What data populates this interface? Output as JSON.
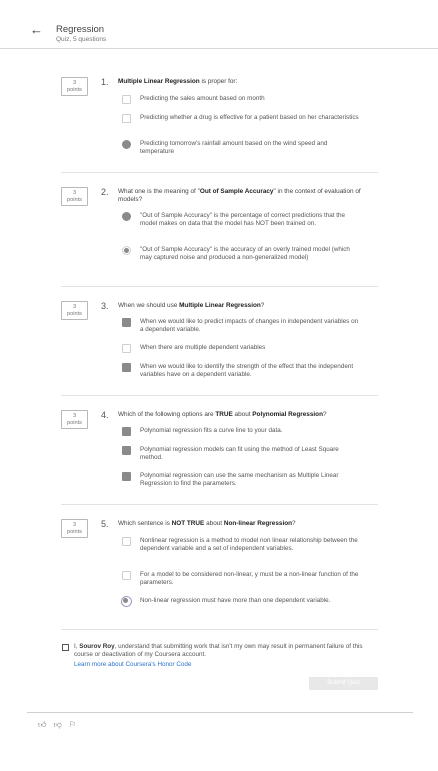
{
  "header": {
    "back_icon": "arrow-left-icon",
    "title": "Regression",
    "subtitle": "Quiz, 5 questions"
  },
  "questions": [
    {
      "points": "3\npoints",
      "number": "1.",
      "text_bold": "Multiple Linear Regression",
      "text_rest": " is proper for:",
      "options": [
        {
          "text": "Predicting the sales amount based on month",
          "state": "unchecked"
        },
        {
          "text": "Predicting whether a drug is effective for a patient based on her characteristics",
          "state": "unchecked"
        },
        {
          "text": "Predicting tomorrow's rainfall amount based on the wind speed and temperature",
          "state": "radio-filled"
        }
      ]
    },
    {
      "points": "3\npoints",
      "number": "2.",
      "text_pre": "What one is the meaning of \"",
      "text_bold": "Out of Sample Accuracy",
      "text_rest": "\" in the context of evaluation of models?",
      "options": [
        {
          "text": "\"Out of Sample Accuracy\" is the percentage of correct predictions that the model makes on data that the model has NOT been trained on.",
          "state": "radio-filled"
        },
        {
          "text": "\"Out of Sample Accuracy\" is the accuracy of an overly trained model (which may captured noise and produced a non-generalized model)",
          "state": "unchecked"
        }
      ]
    },
    {
      "points": "3\npoints",
      "number": "3.",
      "text_pre": "When we should use ",
      "text_bold": "Multiple Linear Regression",
      "text_rest": "?",
      "options": [
        {
          "text": "When we would like to predict impacts of changes in independent variables on a dependent variable.",
          "state": "checked"
        },
        {
          "text": "When there are multiple dependent variables",
          "state": "unchecked"
        },
        {
          "text": "When we would like to identify the strength of the effect that the independent variables have on a dependent variable.",
          "state": "checked"
        }
      ]
    },
    {
      "points": "3\npoints",
      "number": "4.",
      "text_pre": "Which of the following options are ",
      "text_bold": "TRUE",
      "text_mid": " about ",
      "text_bold2": "Polynomial Regression",
      "text_rest": "?",
      "options": [
        {
          "text": "Polynomial regression fits a curve line to your data.",
          "state": "checked"
        },
        {
          "text": "Polynomial regression models can fit using the method of Least Square method.",
          "state": "checked"
        },
        {
          "text": "Polynomial regression can use the same mechanism as Multiple Linear Regression to find the parameters.",
          "state": "checked"
        }
      ]
    },
    {
      "points": "3\npoints",
      "number": "5.",
      "text_pre": "Which sentence is ",
      "text_bold": "NOT TRUE",
      "text_mid": " about ",
      "text_bold2": "Non-linear Regression",
      "text_rest": "?",
      "options": [
        {
          "text": "Nonlinear regression is a method to model non linear relationship between the dependent variable and a set of independent variables.",
          "state": "unchecked"
        },
        {
          "text": "For a model to be considered non-linear, y must be a non-linear function of the parameters.",
          "state": "unchecked"
        },
        {
          "text": "Non-linear regression must have more than one dependent variable.",
          "state": "radio-selected"
        }
      ]
    }
  ],
  "honor": {
    "prefix": "I, ",
    "name": "Sourov Roy",
    "text": ", understand that submitting work that isn't my own may result in permanent failure of this course or deactivation of my Coursera account.",
    "link": "Learn more about Coursera's Honor Code"
  },
  "submit_label": "Submit Quiz",
  "footer": {
    "icons": [
      "thumbs-up-icon",
      "thumbs-down-icon",
      "flag-icon"
    ]
  }
}
